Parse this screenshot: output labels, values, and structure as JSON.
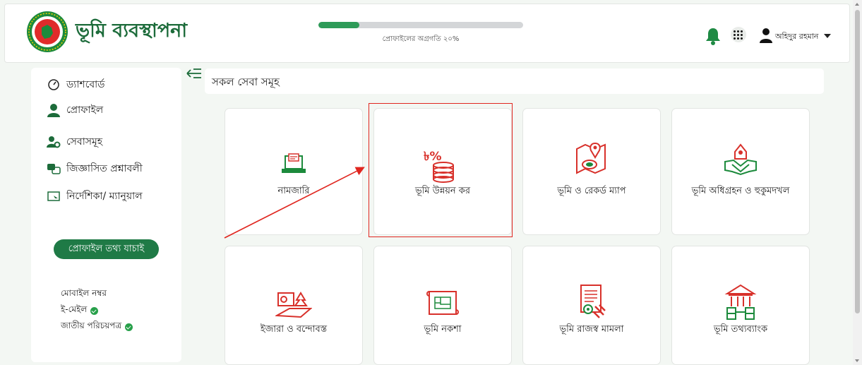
{
  "header": {
    "brand": "ভূমি ব্যবস্থাপনা",
    "progress_text": "প্রোফাইলের অগ্রগতি ২০%",
    "progress_fraction": 0.2,
    "user_name": "অহিদুর রহমান"
  },
  "sidebar": {
    "items": [
      {
        "label": "ড্যাশবোর্ড",
        "icon": "gauge-icon"
      },
      {
        "label": "প্রোফাইল",
        "icon": "user-icon"
      },
      {
        "label": "সেবাসমূহ",
        "icon": "users-gear-icon"
      },
      {
        "label": "জিজ্ঞাসিত প্রশ্নাবলী",
        "icon": "faq-icon"
      },
      {
        "label": "নির্দেশিকা/ ম্যানুয়াল",
        "icon": "manual-icon"
      }
    ],
    "verify_button": "প্রোফাইল তথ্য যাচাই",
    "info": {
      "mobile": "মোবাইল নম্বর",
      "email": "ই-মেইল",
      "nid": "জাতীয় পরিচয়পত্র"
    }
  },
  "main": {
    "section_title": "সকল সেবা সমূহ",
    "services": [
      {
        "label": "নামজারি",
        "icon": "namjari-icon"
      },
      {
        "label": "ভূমি উন্নয়ন কর",
        "icon": "land-tax-icon"
      },
      {
        "label": "ভূমি ও রেকর্ড ম্যাপ",
        "icon": "map-record-icon"
      },
      {
        "label": "ভূমি অধিগ্রহন ও হুকুমদখল",
        "icon": "acquisition-icon"
      },
      {
        "label": "ইজারা ও বন্দোবস্ত",
        "icon": "lease-icon"
      },
      {
        "label": "ভূমি নকশা",
        "icon": "land-design-icon"
      },
      {
        "label": "ভূমি রাজস্ব মামলা",
        "icon": "revenue-case-icon"
      },
      {
        "label": "ভূমি তথ্যব্যাংক",
        "icon": "databank-icon"
      }
    ],
    "tax_icon_text": "৳%"
  },
  "colors": {
    "brand_green": "#1c6b3a",
    "button_green": "#1f7a46",
    "icon_red": "#d8312b",
    "highlight_red": "#e0261f"
  }
}
